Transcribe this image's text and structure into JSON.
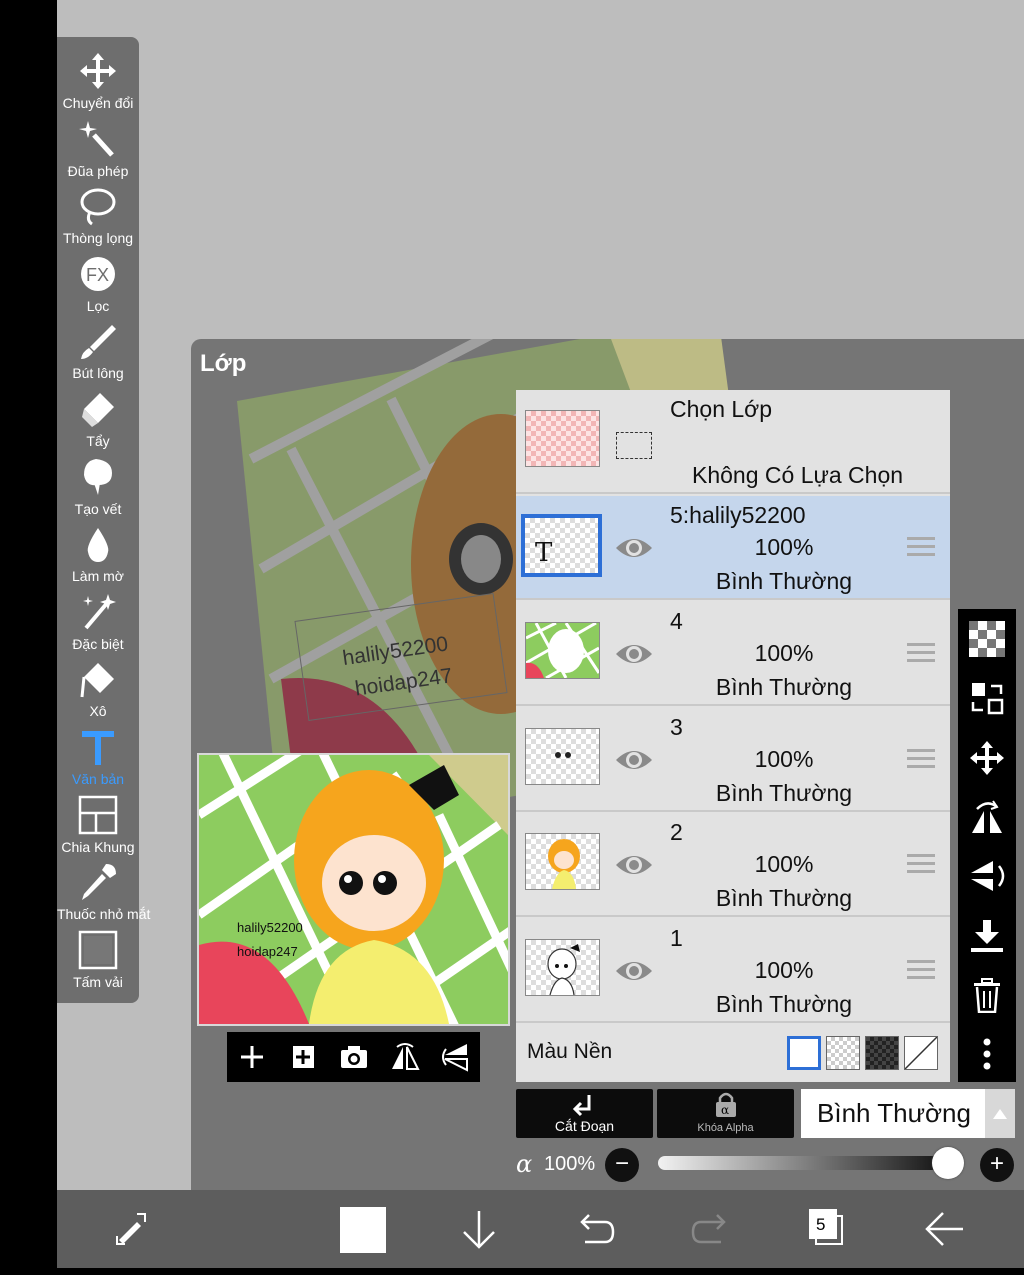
{
  "toolbox": {
    "tools": [
      {
        "label": "Chuyển đổi",
        "icon": "move-arrows-icon"
      },
      {
        "label": "Đũa phép",
        "icon": "magic-wand-icon"
      },
      {
        "label": "Thòng lọng",
        "icon": "lasso-icon"
      },
      {
        "label": "Lọc",
        "icon": "fx-filter-icon"
      },
      {
        "label": "Bút lông",
        "icon": "brush-icon"
      },
      {
        "label": "Tẩy",
        "icon": "eraser-icon"
      },
      {
        "label": "Tạo vết",
        "icon": "smudge-icon"
      },
      {
        "label": "Làm mờ",
        "icon": "blur-drop-icon"
      },
      {
        "label": "Đặc biệt",
        "icon": "special-sparkle-icon"
      },
      {
        "label": "Xô",
        "icon": "bucket-icon"
      },
      {
        "label": "Văn bản",
        "icon": "text-tool-icon",
        "active": true
      },
      {
        "label": "Chia Khung",
        "icon": "frame-divider-icon"
      },
      {
        "label": "Thuốc nhỏ mắt",
        "icon": "eyedropper-icon"
      },
      {
        "label": "Tấm vải",
        "icon": "canvas-icon"
      }
    ],
    "active_color": "#3a9bff"
  },
  "panel": {
    "title": "Lớp"
  },
  "canvas_text": {
    "line1": "halily52200",
    "line2": "hoidap247"
  },
  "preview": {
    "text1": "halily52200",
    "text2": "hoidap247",
    "tools": [
      "add-layer-icon",
      "add-layer-copy-icon",
      "camera-icon",
      "flip-horizontal-icon",
      "flip-vertical-icon"
    ]
  },
  "selection_row": {
    "title": "Chọn Lớp",
    "subtitle": "Không Có Lựa Chọn"
  },
  "layers": [
    {
      "name": "5:halily52200",
      "opacity": "100%",
      "mode": "Bình Thường",
      "selected": true,
      "thumb": "text"
    },
    {
      "name": "4",
      "opacity": "100%",
      "mode": "Bình Thường",
      "selected": false,
      "thumb": "background"
    },
    {
      "name": "3",
      "opacity": "100%",
      "mode": "Bình Thường",
      "selected": false,
      "thumb": "face"
    },
    {
      "name": "2",
      "opacity": "100%",
      "mode": "Bình Thường",
      "selected": false,
      "thumb": "color"
    },
    {
      "name": "1",
      "opacity": "100%",
      "mode": "Bình Thường",
      "selected": false,
      "thumb": "lineart"
    }
  ],
  "background_color": {
    "label": "Màu Nền",
    "options": [
      "white",
      "checker-light",
      "checker-dark",
      "none"
    ],
    "selected": "white"
  },
  "right_tools": [
    "checkerboard-icon",
    "swap-layer-icon",
    "move-icon",
    "flip-rotate-horizontal-icon",
    "flip-rotate-vertical-icon",
    "merge-down-icon",
    "trash-icon",
    "more-vertical-icon"
  ],
  "buttons": {
    "clip": "Cắt Đoạn",
    "alpha_lock": "Khóa Alpha",
    "blend_mode": "Bình Thường"
  },
  "opacity": {
    "symbol": "α",
    "value": "100%",
    "level": 1.0,
    "minus": "−",
    "plus": "+"
  },
  "bottom_bar": {
    "layer_count": "5",
    "color_swatch": "#ffffff"
  },
  "colors": {
    "panel": "#757575",
    "selected_row": "#c5d6ec",
    "selection_border": "#2d6fd6"
  }
}
